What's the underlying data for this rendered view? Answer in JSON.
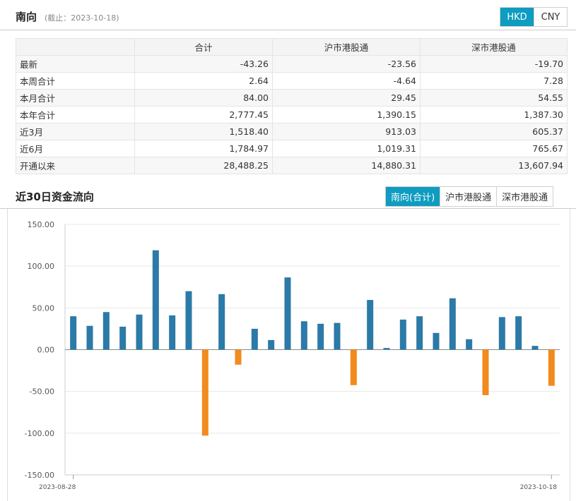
{
  "header": {
    "title": "南向",
    "subtitle": "(截止：2023-10-18)",
    "currency_options": [
      "HKD",
      "CNY"
    ],
    "currency_selected": "HKD"
  },
  "table": {
    "columns": [
      "",
      "合计",
      "沪市港股通",
      "深市港股通"
    ],
    "rows": [
      {
        "label": "最新",
        "total": "-43.26",
        "sh": "-23.56",
        "sz": "-19.70"
      },
      {
        "label": "本周合计",
        "total": "2.64",
        "sh": "-4.64",
        "sz": "7.28"
      },
      {
        "label": "本月合计",
        "total": "84.00",
        "sh": "29.45",
        "sz": "54.55"
      },
      {
        "label": "本年合计",
        "total": "2,777.45",
        "sh": "1,390.15",
        "sz": "1,387.30"
      },
      {
        "label": "近3月",
        "total": "1,518.40",
        "sh": "913.03",
        "sz": "605.37"
      },
      {
        "label": "近6月",
        "total": "1,784.97",
        "sh": "1,019.31",
        "sz": "765.67"
      },
      {
        "label": "开通以来",
        "total": "28,488.25",
        "sh": "14,880.31",
        "sz": "13,607.94"
      }
    ]
  },
  "chart_section": {
    "title": "近30日资金流向",
    "tabs": [
      "南向(合计)",
      "沪市港股通",
      "深市港股通"
    ],
    "active_tab": "南向(合计)"
  },
  "chart_data": {
    "type": "bar",
    "x_start_label": "2023-08-28",
    "x_end_label": "2023-10-18",
    "values": [
      40,
      28.5,
      45,
      27.5,
      42,
      119,
      41,
      70,
      -103,
      66.5,
      -18,
      25,
      11.5,
      86.5,
      34,
      31,
      32,
      -42.5,
      59.5,
      2,
      36,
      40,
      20,
      61.5,
      12.5,
      -54.5,
      39,
      40,
      4.5,
      -43.26
    ],
    "yticks": [
      "150.00",
      "100.00",
      "50.00",
      "0.00",
      "-50.00",
      "-100.00",
      "-150.00"
    ],
    "ylim": [
      -150,
      150
    ],
    "grid": true,
    "colors": {
      "positive": "#2b7aa8",
      "negative": "#f28a1e"
    }
  }
}
